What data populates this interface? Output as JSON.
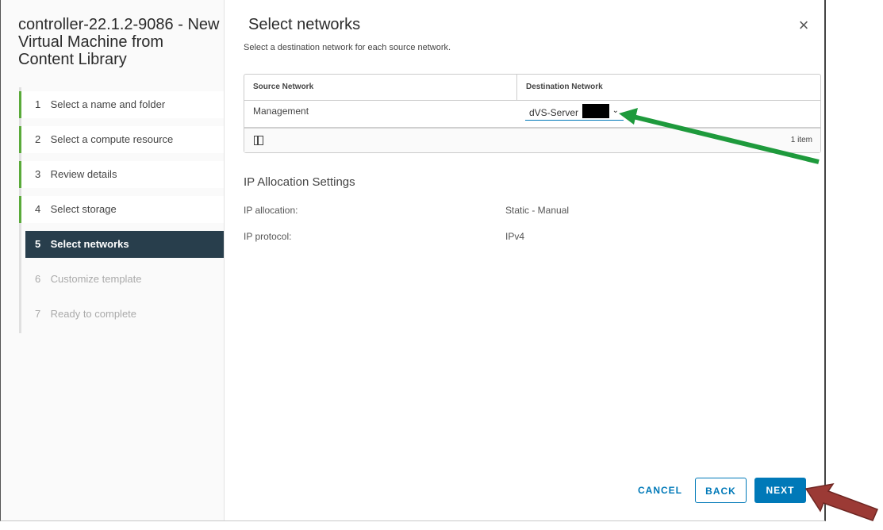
{
  "wizard": {
    "title": "controller-22.1.2-9086 - New Virtual Machine from Content Library",
    "steps": [
      {
        "num": "1",
        "label": "Select a name and folder",
        "state": "completed"
      },
      {
        "num": "2",
        "label": "Select a compute resource",
        "state": "completed"
      },
      {
        "num": "3",
        "label": "Review details",
        "state": "completed"
      },
      {
        "num": "4",
        "label": "Select storage",
        "state": "completed"
      },
      {
        "num": "5",
        "label": "Select networks",
        "state": "active"
      },
      {
        "num": "6",
        "label": "Customize template",
        "state": "disabled"
      },
      {
        "num": "7",
        "label": "Ready to complete",
        "state": "disabled"
      }
    ]
  },
  "page": {
    "title": "Select networks",
    "subtitle": "Select a destination network for each source network."
  },
  "grid": {
    "columns": [
      "Source Network",
      "Destination Network"
    ],
    "rows": [
      {
        "source": "Management",
        "destination": "dVS-Server"
      }
    ],
    "footer_count": "1 item"
  },
  "ip_settings": {
    "title": "IP Allocation Settings",
    "allocation_label": "IP allocation:",
    "allocation_value": "Static - Manual",
    "protocol_label": "IP protocol:",
    "protocol_value": "IPv4"
  },
  "buttons": {
    "cancel": "CANCEL",
    "back": "BACK",
    "next": "NEXT"
  },
  "colors": {
    "active_step": "#283e4c",
    "completed_step": "#5aaa3a",
    "primary": "#0079b8",
    "annotation_green": "#1e9a3c",
    "annotation_red": "#9b3a35"
  },
  "icons": {
    "close": "close-icon",
    "dropdown": "chevron-down-icon",
    "columns": "column-toggle-icon"
  }
}
